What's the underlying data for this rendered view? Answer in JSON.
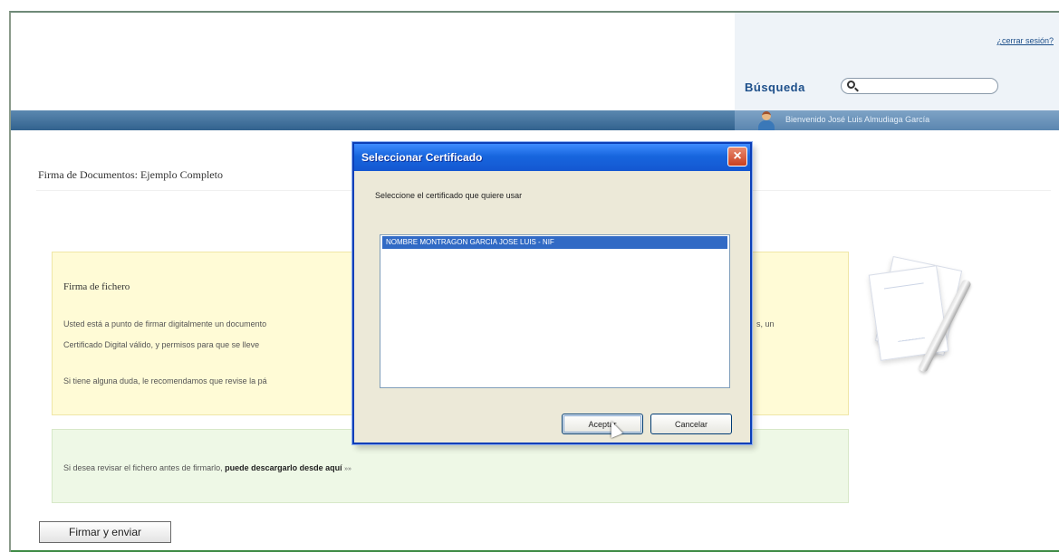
{
  "header": {
    "logout_link": "¿cerrar sesión?",
    "search_label": "Búsqueda",
    "search_placeholder": "",
    "welcome_text": "Bienvenido José Luis Almudiaga García"
  },
  "page": {
    "title": "Firma de Documentos: Ejemplo Completo",
    "submit_button": "Firmar y enviar"
  },
  "yellow_panel": {
    "heading": "Firma de fichero",
    "lines": [
      "Usted está a punto de firmar digitalmente un documento",
      "Certificado Digital válido, y permisos para que se lleve",
      "Si tiene alguna duda, le recomendamos que revise la pá"
    ],
    "right_fragment": "s, un"
  },
  "green_panel": {
    "text": "Si desea revisar el fichero antes de firmarlo, ",
    "link": "puede descargarlo desde aquí",
    "arrow": "»»"
  },
  "dialog": {
    "title": "Seleccionar Certificado",
    "close_symbol": "×",
    "instruction": "Seleccione el certificado que quiere usar",
    "certificates": [
      "NOMBRE MONTRAGON GARCIA JOSE LUIS - NIF"
    ],
    "accept_button": "Aceptar",
    "cancel_button": "Cancelar"
  },
  "icons": {
    "search": "search-icon",
    "user": "user-avatar-icon",
    "document": "document-signature-icon",
    "cursor": "mouse-pointer-icon"
  },
  "colors": {
    "nav_blue": "#32628e",
    "dialog_blue": "#1766de",
    "yellow_panel": "#fffbd6",
    "green_panel": "#eef8e6"
  }
}
